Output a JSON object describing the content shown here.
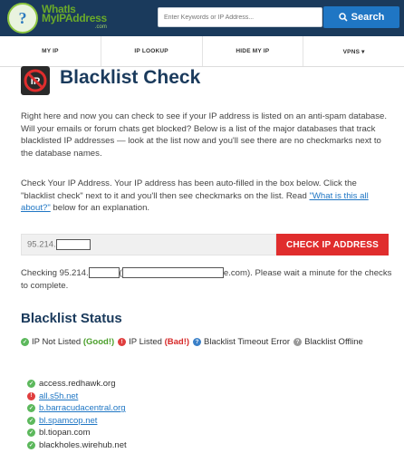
{
  "header": {
    "logo_line1": "WhatIs",
    "logo_line2": "MyIPAddress",
    "logo_line3": ".com",
    "search_placeholder": "Enter Keywords or IP Address...",
    "search_button": "Search"
  },
  "nav": [
    {
      "label": "MY IP"
    },
    {
      "label": "IP LOOKUP"
    },
    {
      "label": "HIDE MY IP"
    },
    {
      "label": "VPNS ▾"
    }
  ],
  "page": {
    "title": "Blacklist Check",
    "intro": "Right here and now you can check to see if your IP address is listed on an anti-spam database. Will your emails or forum chats get blocked? Below is a list of the major databases that track blacklisted IP addresses — look at the list now and you'll see there are no checkmarks next to the database names.",
    "instructions_pre": "Check Your IP Address. Your IP address has been auto-filled in the box below. Click the \"blacklist check\" next to it and you'll then see checkmarks on the list. Read ",
    "instructions_link": "\"What is this all about?\"",
    "instructions_post": " below for an explanation.",
    "ip_value": "95.214.",
    "check_button": "CHECK IP ADDRESS",
    "checking_pre": "Checking 95.214.",
    "checking_mid": "(",
    "checking_suffix": "e.com). Please wait a minute for the checks to complete."
  },
  "status": {
    "heading": "Blacklist Status",
    "legend": {
      "not_listed": "IP Not Listed",
      "good": "(Good!)",
      "listed": "IP Listed",
      "bad": "(Bad!)",
      "timeout": "Blacklist Timeout Error",
      "offline": "Blacklist Offline"
    }
  },
  "blacklists": [
    {
      "name": "access.redhawk.org",
      "status": "good",
      "link": false
    },
    {
      "name": "all.s5h.net",
      "status": "bad",
      "link": true
    },
    {
      "name": "b.barracudacentral.org",
      "status": "good",
      "link": true
    },
    {
      "name": "bl.spamcop.net",
      "status": "good",
      "link": true
    },
    {
      "name": "bl.tiopan.com",
      "status": "good",
      "link": false
    },
    {
      "name": "blackholes.wirehub.net",
      "status": "good",
      "link": false
    }
  ],
  "colors": {
    "header_bg": "#1a3a5c",
    "accent_blue": "#1f76c4",
    "accent_red": "#e02d2d",
    "good_green": "#5cb85c"
  }
}
